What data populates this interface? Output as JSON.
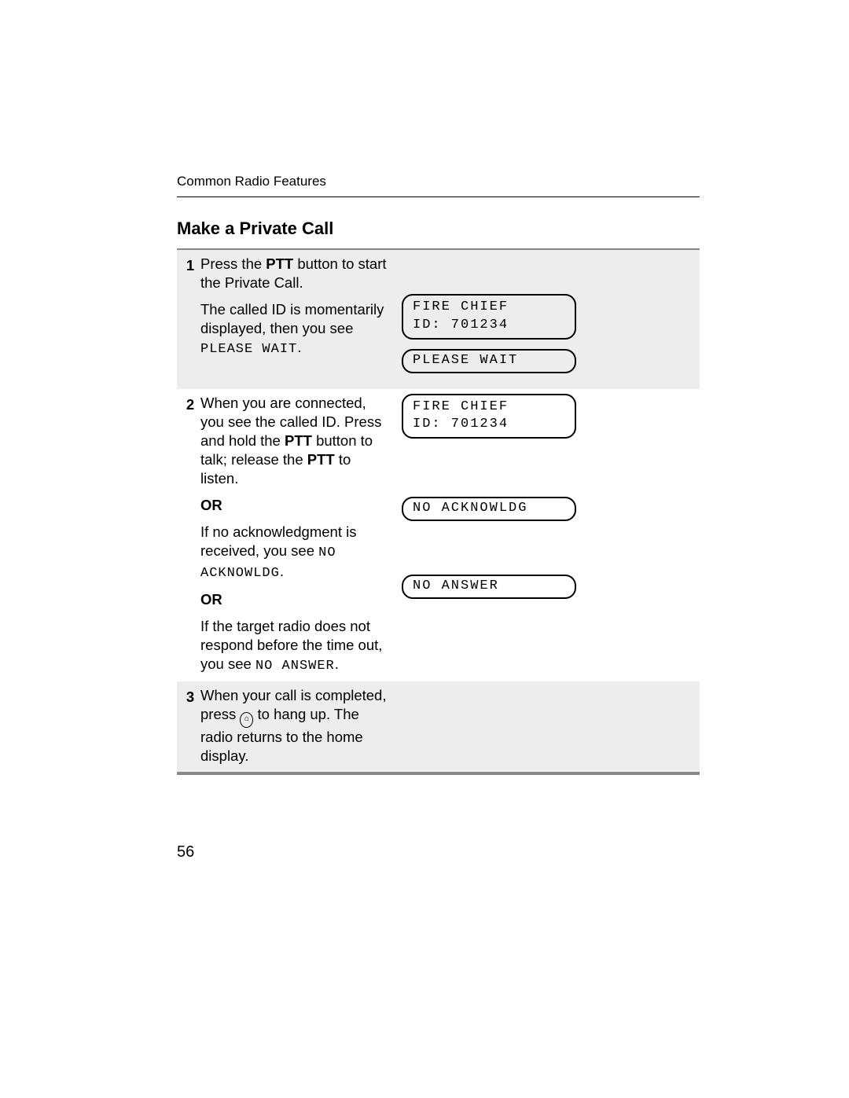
{
  "header": "Common Radio Features",
  "title": "Make a Private Call",
  "or_label": "OR",
  "page_number": "56",
  "steps": {
    "s1": {
      "num": "1",
      "p1_a": "Press the ",
      "p1_b": "PTT",
      "p1_c": " button to start the Private Call.",
      "p2_a": "The called ID is momentarily displayed, then you see ",
      "p2_lcd": "PLEASE WAIT",
      "p2_b": ".",
      "display1": "FIRE CHIEF\nID: 701234",
      "display2": "PLEASE WAIT"
    },
    "s2": {
      "num": "2",
      "p1_a": "When you are connected, you see the called ID. Press and hold the ",
      "p1_b": "PTT",
      "p1_c": " button to talk; release the ",
      "p1_d": "PTT",
      "p1_e": " to listen.",
      "p2_a": "If no acknowledgment is received, you see ",
      "p2_lcd": "NO ACKNOWLDG",
      "p2_b": ".",
      "p3_a": "If the target radio does not respond before the time out, you see ",
      "p3_lcd": "NO ANSWER",
      "p3_b": ".",
      "display1": "FIRE CHIEF\nID: 701234",
      "display2": "NO ACKNOWLDG",
      "display3": "NO ANSWER"
    },
    "s3": {
      "num": "3",
      "p1_a": "When your call is completed, press ",
      "icon_glyph": "⌂",
      "p1_b": " to hang up. The radio returns to the home display."
    }
  }
}
